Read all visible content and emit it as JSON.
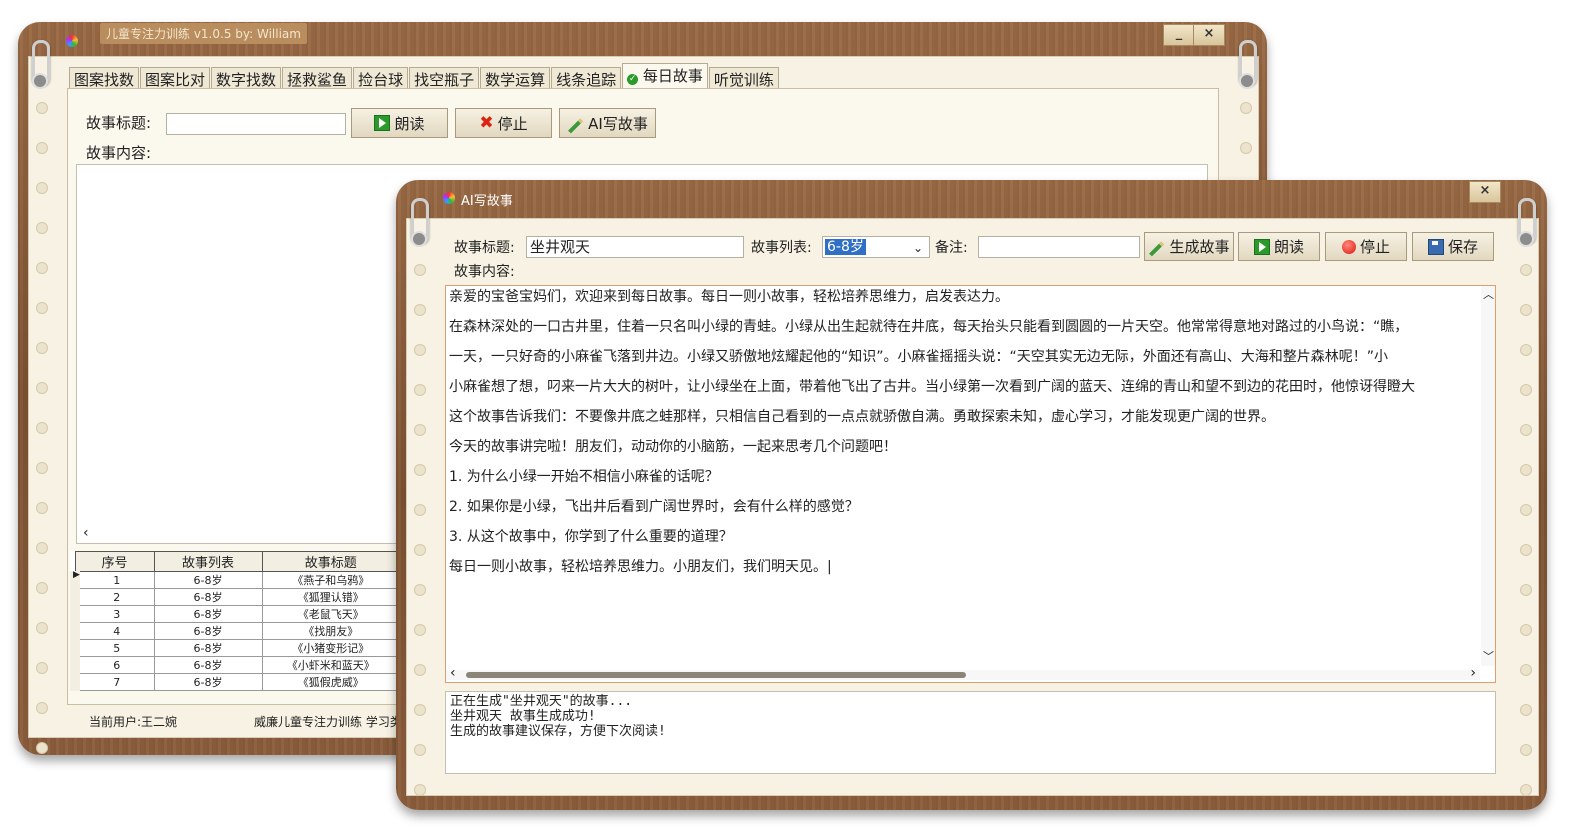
{
  "main_window": {
    "title": "儿童专注力训练 v1.0.5 by: William",
    "minimize": "_",
    "close": "×",
    "tabs": [
      "图案找数",
      "图案比对",
      "数字找数",
      "拯救鲨鱼",
      "捡台球",
      "找空瓶子",
      "数学运算",
      "线条追踪",
      "每日故事",
      "听觉训练"
    ],
    "active_tab": "每日故事",
    "story_title_label": "故事标题:",
    "story_title_value": "",
    "read_button": "朗读",
    "stop_button": "停止",
    "ai_write_button": "AI写故事",
    "story_content_label": "故事内容:",
    "table": {
      "headers": [
        "序号",
        "故事列表",
        "故事标题"
      ],
      "rows": [
        [
          "1",
          "6-8岁",
          "《燕子和乌鸦》"
        ],
        [
          "2",
          "6-8岁",
          "《狐狸认错》"
        ],
        [
          "3",
          "6-8岁",
          "《老鼠飞天》"
        ],
        [
          "4",
          "6-8岁",
          "《找朋友》"
        ],
        [
          "5",
          "6-8岁",
          "《小猪变形记》"
        ],
        [
          "6",
          "6-8岁",
          "《小虾米和蓝天》"
        ],
        [
          "7",
          "6-8岁",
          "《狐假虎威》"
        ]
      ]
    },
    "status_user": "当前用户:王二婉",
    "status_app": "威廉儿童专注力训练 学习类"
  },
  "ai_window": {
    "title": "AI写故事",
    "close": "×",
    "story_title_label": "故事标题:",
    "story_title_value": "坐井观天",
    "story_list_label": "故事列表:",
    "story_list_value": "6-8岁",
    "note_label": "备注:",
    "note_value": "",
    "generate_button": "生成故事",
    "read_button": "朗读",
    "stop_button": "停止",
    "save_button": "保存",
    "story_content_label": "故事内容:",
    "story_lines": [
      "亲爱的宝爸宝妈们，欢迎来到每日故事。每日一则小故事，轻松培养思维力，启发表达力。",
      "在森林深处的一口古井里，住着一只名叫小绿的青蛙。小绿从出生起就待在井底，每天抬头只能看到圆圆的一片天空。他常常得意地对路过的小鸟说：“瞧，",
      "一天，一只好奇的小麻雀飞落到井边。小绿又骄傲地炫耀起他的“知识”。小麻雀摇摇头说：“天空其实无边无际，外面还有高山、大海和整片森林呢！”小",
      "小麻雀想了想，叼来一片大大的树叶，让小绿坐在上面，带着他飞出了古井。当小绿第一次看到广阔的蓝天、连绵的青山和望不到边的花田时，他惊讶得瞪大",
      "这个故事告诉我们：不要像井底之蛙那样，只相信自己看到的一点点就骄傲自满。勇敢探索未知，虚心学习，才能发现更广阔的世界。",
      "今天的故事讲完啦！朋友们，动动你的小脑筋，一起来思考几个问题吧！",
      "1. 为什么小绿一开始不相信小麻雀的话呢？",
      "2. 如果你是小绿，飞出井后看到广阔世界时，会有什么样的感觉？",
      "3. 从这个故事中，你学到了什么重要的道理？",
      "每日一则小故事，轻松培养思维力。小朋友们，我们明天见。|"
    ],
    "log_lines": "正在生成\"坐井观天\"的故事...\n坐井观天 故事生成成功!\n生成的故事建议保存，方便下次阅读!"
  },
  "colors": {
    "wood": "#8a5b38",
    "paper": "#f7f2e3",
    "select_highlight": "#2f6fc5",
    "story_border": "#d9a070"
  }
}
